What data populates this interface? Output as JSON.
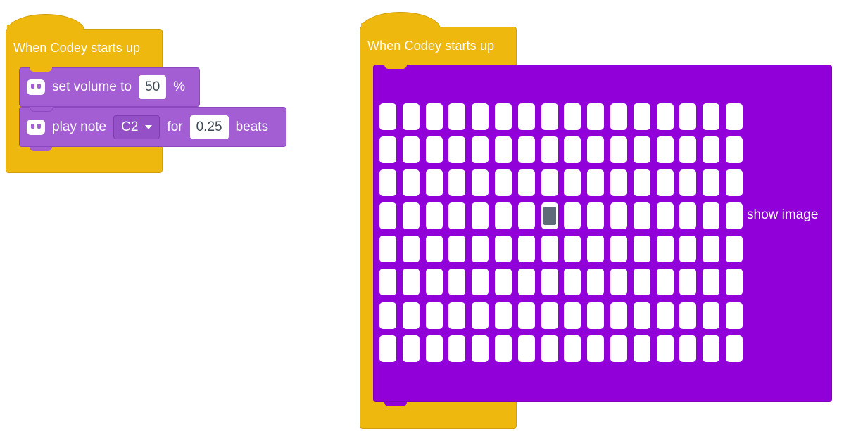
{
  "script_left": {
    "hat_label": "When Codey starts up",
    "blocks": [
      {
        "label": "set volume to",
        "value": "50",
        "suffix": "%"
      },
      {
        "label": "play note",
        "note": "C2",
        "for_label": "for",
        "value": "0.25",
        "suffix": "beats"
      }
    ]
  },
  "script_right": {
    "hat_label": "When Codey starts up",
    "block_label": "show image",
    "matrix": {
      "columns": 16,
      "rows": 8,
      "lit": [
        [
          3,
          7
        ]
      ]
    }
  },
  "colors": {
    "event_yellow": "#efb80f",
    "looks_purple": "#a35ed4",
    "matrix_purple": "#9100d9",
    "led_off": "#ffffff",
    "led_on": "#5e6a78"
  },
  "icons": {
    "codey": "codey-robot-icon",
    "dropdown": "dropdown-caret-icon"
  }
}
